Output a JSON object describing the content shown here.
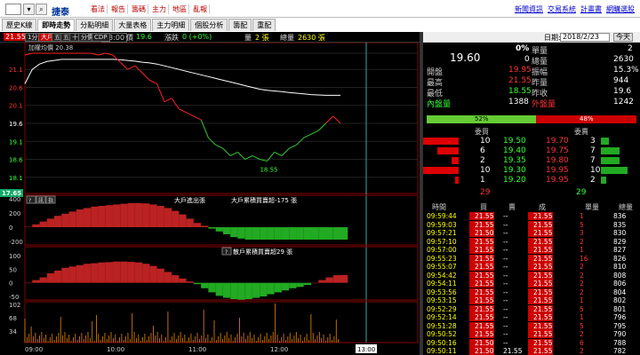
{
  "header": {
    "input_placeholder": "",
    "stock_name": "捷泰",
    "menu": [
      "看法",
      "報告",
      "籌碼",
      "主力",
      "地區",
      "亂報"
    ],
    "links": [
      "新聞資訊",
      "交易系統",
      "計畫書",
      "網購選股"
    ]
  },
  "tabs": [
    "歷史K線",
    "即時走勢",
    "分點明細",
    "大量表格",
    "主力明細",
    "個股分析",
    "籌配",
    "重配"
  ],
  "active_tab": "即時走勢",
  "toolbar": {
    "buttons": [
      "1分",
      "大戶",
      "五",
      "五",
      "十",
      "分價",
      "CDP"
    ],
    "time": "13:00",
    "price_label": "價",
    "price": "19.6",
    "change_label": "漲跌",
    "change": "0 (+0%)",
    "vol_label": "量",
    "vol": "2 張",
    "total_label": "總量",
    "total": "2630 張"
  },
  "chart_data": {
    "type": "line",
    "title": "",
    "avg_label": "加權均價 20.38",
    "y_ticks": [
      "21.55",
      "21.1",
      "20.6",
      "20.1",
      "19.6",
      "19.1",
      "18.6",
      "18.1",
      "17.65"
    ],
    "y_top": "21.55",
    "y_bottom": "17.65",
    "low_label": "18.55",
    "x_ticks": [
      "09:00",
      "10:00",
      "11:00",
      "12:00",
      "13:00"
    ],
    "x_current": "13:00",
    "price_series": [
      21.5,
      21.55,
      21.55,
      21.55,
      21.55,
      21.55,
      21.55,
      21.55,
      21.55,
      21.55,
      21.5,
      21.55,
      21.5,
      21.3,
      21.1,
      21.2,
      21.0,
      20.8,
      20.7,
      20.2,
      20.3,
      20.0,
      19.9,
      19.8,
      19.7,
      19.2,
      19.0,
      18.9,
      18.7,
      18.8,
      18.6,
      18.7,
      18.6,
      18.55,
      18.8,
      18.7,
      18.9,
      19.0,
      19.2,
      19.3,
      19.4,
      19.6,
      19.8,
      19.6
    ],
    "avg_series": [
      20.7,
      21.1,
      21.25,
      21.32,
      21.35,
      21.38,
      21.38,
      21.38,
      21.38,
      21.38,
      21.38,
      21.38,
      21.38,
      21.37,
      21.35,
      21.33,
      21.3,
      21.28,
      21.25,
      21.2,
      21.15,
      21.1,
      21.05,
      21.0,
      20.95,
      20.9,
      20.85,
      20.8,
      20.75,
      20.7,
      20.65,
      20.6,
      20.55,
      20.52,
      20.5,
      20.48,
      20.46,
      20.44,
      20.42,
      20.4,
      20.39,
      20.38,
      20.38,
      20.38
    ],
    "panel1": {
      "buttons": [
        "?",
        "訊",
        "指"
      ],
      "label1": "大戶進出張",
      "label2": "大戶累積買賣超-175 張",
      "y_ticks": [
        "400",
        "200",
        "0",
        "-200"
      ],
      "values": [
        5,
        40,
        80,
        120,
        160,
        190,
        220,
        250,
        270,
        290,
        300,
        310,
        320,
        330,
        340,
        340,
        335,
        320,
        300,
        270,
        230,
        180,
        120,
        60,
        20,
        -20,
        -60,
        -100,
        -140,
        -160,
        -175,
        -175,
        -175,
        -175,
        -175,
        -175,
        -175,
        -175,
        -175,
        -175,
        -175,
        -175,
        -175,
        -175
      ]
    },
    "panel2": {
      "buttons": [
        "?"
      ],
      "label": "散戶累積買賣超29 張",
      "y_ticks": [
        "100",
        "50",
        "0",
        "-50"
      ],
      "values": [
        0,
        10,
        20,
        35,
        45,
        55,
        60,
        65,
        70,
        72,
        75,
        76,
        78,
        78,
        77,
        75,
        70,
        62,
        52,
        40,
        28,
        16,
        5,
        -5,
        -20,
        -35,
        -48,
        -55,
        -60,
        -62,
        -60,
        -55,
        -50,
        -42,
        -35,
        -28,
        -20,
        -15,
        -8,
        0,
        10,
        20,
        28,
        29
      ]
    },
    "panel3": {
      "y_ticks": [
        "102",
        "68",
        "34"
      ]
    }
  },
  "quote": {
    "date_label": "日期:",
    "date": "2018/2/23",
    "today_btn": "今天",
    "price": "19.60",
    "change_pct": "0%",
    "change": "0",
    "single_label": "單量",
    "single": "2",
    "total_label": "總量",
    "total": "2630",
    "rows": [
      [
        "開盤",
        "19.95",
        "振幅",
        "15.3%"
      ],
      [
        "最高",
        "21.55",
        "昨量",
        "944"
      ],
      [
        "最低",
        "18.55",
        "昨收",
        "19.6"
      ],
      [
        "內盤量",
        "1388",
        "外盤量",
        "1242"
      ]
    ],
    "buy_pct": "52%",
    "sell_pct": "48%",
    "buy_frac": 0.52
  },
  "order_book": {
    "headers": [
      "委買",
      "委賣"
    ],
    "rows": [
      {
        "bq": "10",
        "bp": "19.50",
        "sp": "19.70",
        "sq": "3"
      },
      {
        "bq": "6",
        "bp": "19.40",
        "sp": "19.75",
        "sq": "7"
      },
      {
        "bq": "2",
        "bp": "19.35",
        "sp": "19.80",
        "sq": "7"
      },
      {
        "bq": "10",
        "bp": "19.30",
        "sp": "19.95",
        "sq": "10"
      },
      {
        "bq": "1",
        "bp": "19.20",
        "sp": "19.95",
        "sq": "2"
      }
    ],
    "buy_total": "29",
    "sell_total": "29"
  },
  "trades": {
    "headers": [
      "時間",
      "買",
      "賣",
      "成",
      "單量",
      "總量"
    ],
    "rows": [
      [
        "09:59:44",
        "21.55",
        "--",
        "21.55",
        "1",
        "836"
      ],
      [
        "09:59:03",
        "21.55",
        "--",
        "21.55",
        "5",
        "835"
      ],
      [
        "09:57:21",
        "21.50",
        "--",
        "21.55",
        "3",
        "830"
      ],
      [
        "09:57:10",
        "21.55",
        "--",
        "21.55",
        "2",
        "829"
      ],
      [
        "09:57:00",
        "21.55",
        "--",
        "21.55",
        "1",
        "827"
      ],
      [
        "09:55:23",
        "21.55",
        "--",
        "21.55",
        "16",
        "826"
      ],
      [
        "09:55:07",
        "21.55",
        "--",
        "21.55",
        "2",
        "810"
      ],
      [
        "09:54:42",
        "21.55",
        "--",
        "21.55",
        "2",
        "808"
      ],
      [
        "09:54:11",
        "21.55",
        "--",
        "21.55",
        "2",
        "806"
      ],
      [
        "09:53:56",
        "21.55",
        "--",
        "21.55",
        "2",
        "804"
      ],
      [
        "09:53:15",
        "21.55",
        "--",
        "21.55",
        "1",
        "802"
      ],
      [
        "09:52:29",
        "21.55",
        "--",
        "21.55",
        "5",
        "801"
      ],
      [
        "09:52:14",
        "21.55",
        "--",
        "21.55",
        "1",
        "796"
      ],
      [
        "09:51:28",
        "21.55",
        "--",
        "21.55",
        "5",
        "795"
      ],
      [
        "09:50:52",
        "21.55",
        "--",
        "21.55",
        "2",
        "790"
      ],
      [
        "09:50:16",
        "21.50",
        "--",
        "21.55",
        "6",
        "788"
      ],
      [
        "09:50:11",
        "21.50",
        "21.55",
        "21.55",
        "2",
        "782"
      ]
    ]
  }
}
